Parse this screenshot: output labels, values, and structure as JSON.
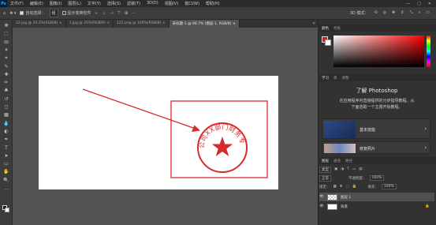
{
  "app": {
    "logo": "Ps"
  },
  "menu": [
    "文件(F)",
    "编辑(E)",
    "图像(I)",
    "图层(L)",
    "文字(Y)",
    "选择(S)",
    "滤镜(T)",
    "3D(D)",
    "视图(V)",
    "窗口(W)",
    "帮助(H)"
  ],
  "window_controls": [
    "—",
    "□",
    "✕"
  ],
  "options": {
    "auto_select_label": "自动选择：",
    "auto_select_value": "组",
    "show_transform_label": "显示变换控件",
    "mode_3d_label": "3D 模式："
  },
  "tabs": [
    {
      "label": "22.jpg @ 33.3%(RGB/8) ×",
      "active": false
    },
    {
      "label": "1.jpg @ 25%(RGB/8) ×",
      "active": false
    },
    {
      "label": "122.png @ 100%(RGB/8) ×",
      "active": false
    },
    {
      "label": "未标题-1 @ 66.7% (图层 1, RGB/8) ×",
      "active": true
    }
  ],
  "tabs_more": "»",
  "tools": [
    "move-tool",
    "marquee-tool",
    "lasso-tool",
    "magic-wand-tool",
    "crop-tool",
    "eyedropper-tool",
    "healing-tool",
    "brush-tool",
    "stamp-tool",
    "history-brush-tool",
    "eraser-tool",
    "gradient-tool",
    "blur-tool",
    "dodge-tool",
    "pen-tool",
    "type-tool",
    "path-select-tool",
    "shape-tool",
    "hand-tool",
    "zoom-tool",
    "more-tool"
  ],
  "tool_glyphs": [
    "✥",
    "⬚",
    "ꝏ",
    "✶",
    "⌗",
    "✎",
    "✚",
    "✏",
    "♣",
    "↺",
    "◻",
    "▦",
    "💧",
    "◐",
    "✒",
    "T",
    "➤",
    "▭",
    "✋",
    "🔍",
    "…"
  ],
  "color_panel": {
    "tabs": [
      "颜色",
      "色板"
    ],
    "fg": "#d11e1e",
    "bg": "#ffffff"
  },
  "learn_panel": {
    "tabs": [
      "学习",
      "库",
      "调整"
    ],
    "title": "了解 Photoshop",
    "desc_line1": "在应用程序内直接提供的分步指导教程。从",
    "desc_line2": "下面选取一个主题开始教程。",
    "cards": [
      {
        "label": "基本技能",
        "chev": "›"
      },
      {
        "label": "修复照片",
        "chev": "›"
      }
    ]
  },
  "layers_panel": {
    "tabs": [
      "图层",
      "通道",
      "路径"
    ],
    "kind_label": "类型",
    "blend_mode": "正常",
    "opacity_label": "不透明度：",
    "opacity_value": "100%",
    "lock_label": "锁定：",
    "fill_label": "填充：",
    "fill_value": "100%",
    "layers": [
      {
        "name": "图层 1",
        "selected": true,
        "thumb": "checker"
      },
      {
        "name": "背景",
        "selected": false,
        "thumb": "white",
        "lock": "🔒"
      }
    ],
    "eye": "👁"
  },
  "document": {
    "stamp_text": "XX公司XX部门财务专用章"
  },
  "colors": {
    "stamp_red": "#d42b2b",
    "box_red": "#d42b2b",
    "arrow_red": "#d42b2b"
  }
}
